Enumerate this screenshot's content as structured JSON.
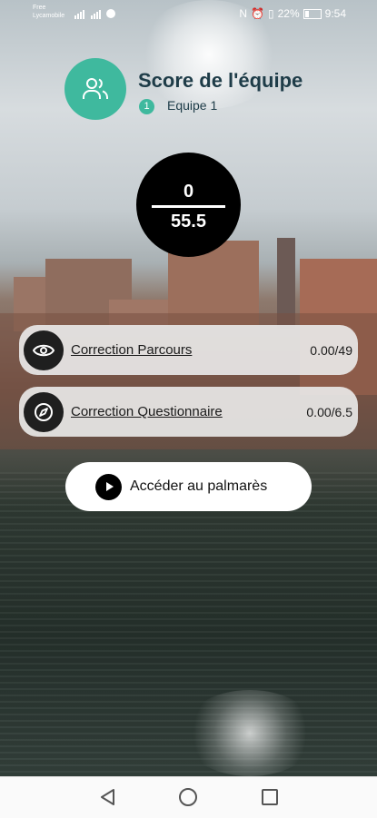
{
  "status_bar": {
    "carrier_line1": "Free",
    "carrier_line2": "Lycamobile",
    "battery": "22%",
    "time": "9:54"
  },
  "header": {
    "title": "Score de l'équipe",
    "team_number": "1",
    "team_name": "Equipe 1"
  },
  "score": {
    "value": "0",
    "max": "55.5"
  },
  "corrections": [
    {
      "label": "Correction Parcours",
      "score": "0.00/49",
      "icon": "eye-icon"
    },
    {
      "label": "Correction Questionnaire",
      "score": "0.00/6.5",
      "icon": "compass-icon"
    }
  ],
  "hall_of_fame_button": {
    "label": "Accéder au palmarès",
    "icon": "play-icon"
  },
  "colors": {
    "accent": "#3fb99e",
    "title": "#1e3c48"
  }
}
